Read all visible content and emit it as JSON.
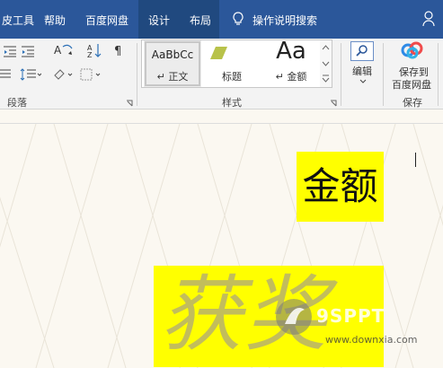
{
  "tabs": [
    {
      "label": "皮工具"
    },
    {
      "label": "帮助"
    },
    {
      "label": "百度网盘"
    },
    {
      "label": "设计"
    },
    {
      "label": "布局"
    }
  ],
  "tellme": {
    "label": "操作说明搜索"
  },
  "ribbon": {
    "paragraph_label": "段落",
    "styles_label": "样式",
    "styles": [
      {
        "sample": "AaBbCc",
        "name": "正文"
      },
      {
        "sample": "",
        "name": "标题"
      },
      {
        "sample": "Aa",
        "name": "金额"
      }
    ],
    "edit_label": "编辑",
    "save_label_line1": "保存到",
    "save_label_line2": "百度网盘",
    "save_group_label": "保存"
  },
  "document": {
    "amount": "金额",
    "award": "获奖"
  },
  "watermark": {
    "brand": "9SPPT",
    "url": "www.downxia.com"
  },
  "colors": {
    "tab_bar": "#2b579a",
    "highlight": "#ffff00",
    "award_text": "#c2bd5c"
  }
}
